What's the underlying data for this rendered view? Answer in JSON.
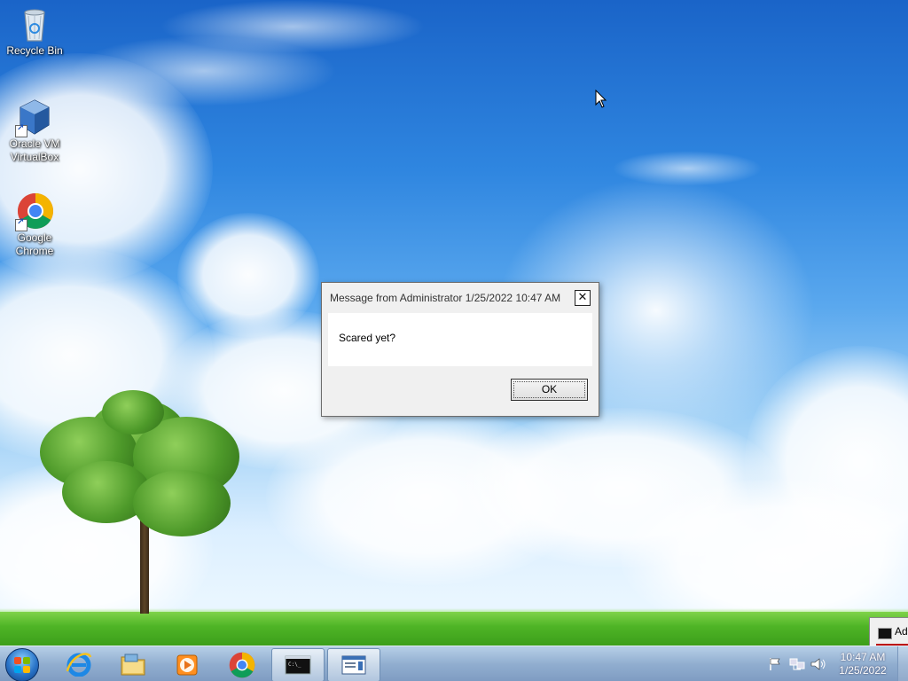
{
  "desktop": {
    "icons": [
      {
        "label_line1": "Recycle Bin",
        "label_line2": "",
        "icon": "recycle-bin-icon"
      },
      {
        "label_line1": "Oracle VM",
        "label_line2": "VirtualBox",
        "icon": "virtualbox-icon"
      },
      {
        "label_line1": "Google",
        "label_line2": "Chrome",
        "icon": "chrome-icon"
      }
    ]
  },
  "dialog": {
    "title": "Message from Administrator 1/25/2022 10:47 AM",
    "close_glyph": "✕",
    "message": "Scared yet?",
    "ok_label": "OK"
  },
  "edge_window": {
    "title_fragment": "Ad"
  },
  "taskbar": {
    "pinned": [
      "windows-start-icon",
      "internet-explorer-icon",
      "file-explorer-icon",
      "media-player-icon",
      "chrome-icon",
      "command-prompt-icon",
      "message-window-icon"
    ],
    "clock": {
      "time": "10:47 AM",
      "date": "1/25/2022"
    },
    "tray_icons": [
      "action-center-flag-icon",
      "network-icon",
      "volume-icon"
    ]
  }
}
